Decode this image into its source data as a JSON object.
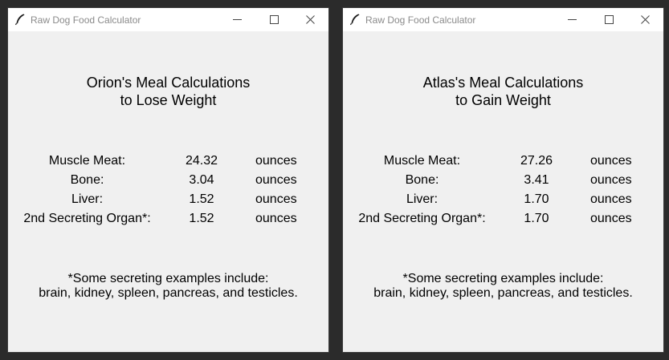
{
  "windows": [
    {
      "title": "Raw Dog Food Calculator",
      "heading_line1": "Orion's Meal Calculations",
      "heading_line2": "to Lose Weight",
      "rows": [
        {
          "label": "Muscle Meat:",
          "value": "24.32",
          "unit": "ounces"
        },
        {
          "label": "Bone:",
          "value": "3.04",
          "unit": "ounces"
        },
        {
          "label": "Liver:",
          "value": "1.52",
          "unit": "ounces"
        },
        {
          "label": "2nd Secreting Organ*:",
          "value": "1.52",
          "unit": "ounces"
        }
      ],
      "footnote_line1": "*Some secreting examples include:",
      "footnote_line2": "brain, kidney, spleen, pancreas, and testicles."
    },
    {
      "title": "Raw Dog Food Calculator",
      "heading_line1": "Atlas's Meal Calculations",
      "heading_line2": "to Gain Weight",
      "rows": [
        {
          "label": "Muscle Meat:",
          "value": "27.26",
          "unit": "ounces"
        },
        {
          "label": "Bone:",
          "value": "3.41",
          "unit": "ounces"
        },
        {
          "label": "Liver:",
          "value": "1.70",
          "unit": "ounces"
        },
        {
          "label": "2nd Secreting Organ*:",
          "value": "1.70",
          "unit": "ounces"
        }
      ],
      "footnote_line1": "*Some secreting examples include:",
      "footnote_line2": "brain, kidney, spleen, pancreas, and testicles."
    }
  ]
}
